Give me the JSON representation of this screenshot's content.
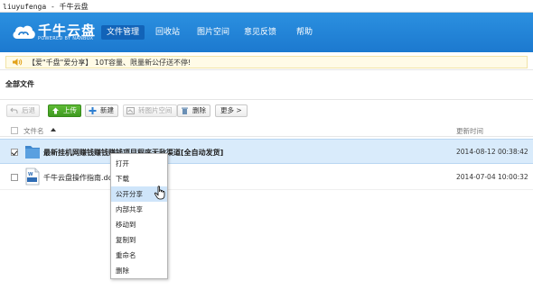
{
  "window": {
    "title": "liuyufenga - 千牛云盘"
  },
  "brand": {
    "name": "千牛云盘",
    "tagline": "POWERED BY NANBOX"
  },
  "nav": [
    "文件管理",
    "回收站",
    "图片空间",
    "意见反馈",
    "帮助"
  ],
  "nav_active_index": 0,
  "notice": {
    "text": "【爱\"千盘\"爱分享】 10T容量、限量新公仔送不停!"
  },
  "breadcrumb": "全部文件",
  "toolbar": {
    "back": "后退",
    "upload": "上传",
    "new_folder": "新建",
    "to_image_space": "转图片空间",
    "delete": "删除",
    "more": "更多 >"
  },
  "table": {
    "col_name": "文件名",
    "col_time": "更新时间",
    "rows": [
      {
        "name": "最新挂机网赚钱赚钱赚钱项目程序无敌渠道[全自动发货]",
        "time": "2014-08-12 00:38:42",
        "type": "folder",
        "checked": true
      },
      {
        "name": "千牛云盘操作指南.doc",
        "time": "2014-07-04 10:00:32",
        "type": "doc",
        "checked": false
      }
    ]
  },
  "context_menu": {
    "items": [
      "打开",
      "下载",
      "公开分享",
      "内部共享",
      "移动到",
      "复制到",
      "重命名",
      "删除"
    ],
    "hover_index": 2
  },
  "colors": {
    "header": "#1c79cf",
    "nav_active": "#1263b8",
    "upload": "#3e9a20",
    "selection": "#d9ebfb"
  }
}
